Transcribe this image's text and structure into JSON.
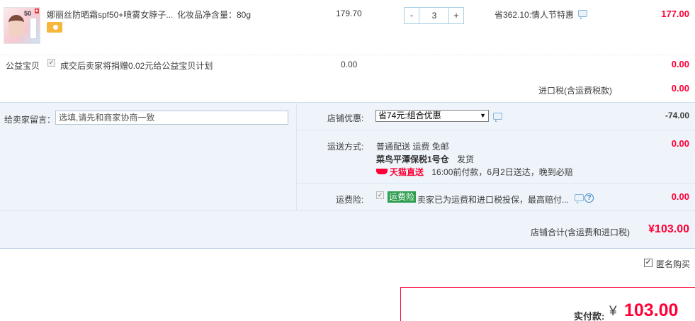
{
  "product": {
    "thumb_tag": "50",
    "title": "娜丽丝防晒霜spf50+喷雾女脖子...",
    "spec": "化妆品净含量：80g",
    "unit_price": "179.70",
    "quantity": "3",
    "discount_text": "省362.10:情人节特惠",
    "subtotal": "177.00",
    "qty_minus": "-",
    "qty_plus": "+"
  },
  "welfare": {
    "label": "公益宝贝",
    "text": "成交后卖家将捐赠0.02元给公益宝贝计划",
    "price": "0.00",
    "amount": "0.00"
  },
  "import_tax": {
    "label": "进口税(含运费税款)",
    "amount": "0.00"
  },
  "message": {
    "label": "给卖家留言：",
    "placeholder": "选填,请先和商家协商一致"
  },
  "shop_discount": {
    "label": "店铺优惠:",
    "selected": "省74元:组合优惠",
    "amount": "-74.00"
  },
  "shipping": {
    "label": "运送方式:",
    "line1": "普通配送 运费 免邮",
    "warehouse": "菜鸟平潭保税1号仓",
    "ship_suffix": "发货",
    "tmall_direct": "天猫直送",
    "eta": "16:00前付款，6月2日送达，晚到必赔",
    "amount": "0.00"
  },
  "insurance": {
    "label": "运费险:",
    "badge": "运费险",
    "text": "卖家已为运费和进口税投保，最高赔付...",
    "help": "?",
    "amount": "0.00"
  },
  "shop_total": {
    "label": "店铺合计(含运费和进口税)",
    "amount": "¥103.00"
  },
  "anonymous": {
    "label": "匿名购买"
  },
  "payment": {
    "label": "实付款:",
    "currency": "¥",
    "amount": "103.00"
  },
  "colors": {
    "price_red": "#ff0036",
    "panel_blue": "#eef4fa",
    "badge_green": "#2e9d4f"
  }
}
